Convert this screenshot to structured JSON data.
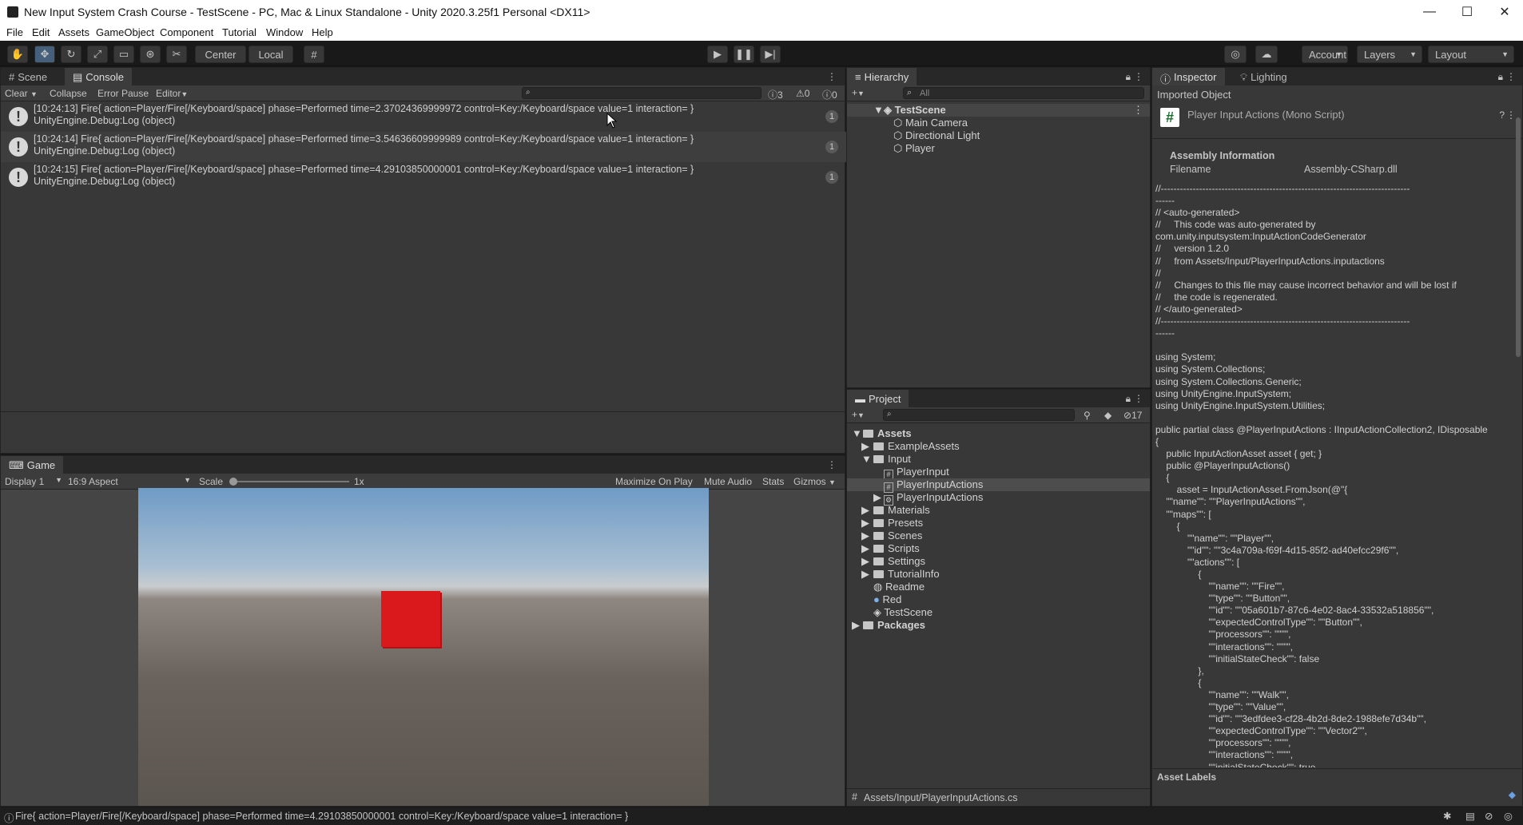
{
  "window": {
    "title": "New Input System Crash Course - TestScene - PC, Mac & Linux Standalone - Unity 2020.3.25f1 Personal <DX11>",
    "minimize": "—",
    "maximize": "☐",
    "close": "✕"
  },
  "menu": [
    "File",
    "Edit",
    "Assets",
    "GameObject",
    "Component",
    "Tutorial",
    "Window",
    "Help"
  ],
  "toolbar": {
    "pivot_center": "Center",
    "pivot_local": "Local",
    "account": "Account",
    "layers": "Layers",
    "layout": "Layout"
  },
  "console": {
    "tab_scene": "Scene",
    "tab_console": "Console",
    "clear": "Clear",
    "collapse": "Collapse",
    "error_pause": "Error Pause",
    "editor": "Editor",
    "count_log": "3",
    "count_warn": "0",
    "count_error": "0",
    "entries": [
      {
        "line1": "[10:24:13] Fire{ action=Player/Fire[/Keyboard/space] phase=Performed time=2.37024369999972 control=Key:/Keyboard/space value=1 interaction= }",
        "line2": "UnityEngine.Debug:Log (object)",
        "count": "1"
      },
      {
        "line1": "[10:24:14] Fire{ action=Player/Fire[/Keyboard/space] phase=Performed time=3.54636609999989 control=Key:/Keyboard/space value=1 interaction= }",
        "line2": "UnityEngine.Debug:Log (object)",
        "count": "1"
      },
      {
        "line1": "[10:24:15] Fire{ action=Player/Fire[/Keyboard/space] phase=Performed time=4.29103850000001 control=Key:/Keyboard/space value=1 interaction= }",
        "line2": "UnityEngine.Debug:Log (object)",
        "count": "1"
      }
    ]
  },
  "game": {
    "tab": "Game",
    "display": "Display 1",
    "aspect": "16:9 Aspect",
    "scale_label": "Scale",
    "scale_value": "1x",
    "maximize_on_play": "Maximize On Play",
    "mute_audio": "Mute Audio",
    "stats": "Stats",
    "gizmos": "Gizmos"
  },
  "hierarchy": {
    "tab": "Hierarchy",
    "search_placeholder": "All",
    "scene": "TestScene",
    "items": [
      "Main Camera",
      "Directional Light",
      "Player"
    ]
  },
  "project": {
    "tab": "Project",
    "hidden_count": "17",
    "path": "Assets/Input/PlayerInputActions.cs",
    "items": [
      {
        "label": "Assets",
        "kind": "folder",
        "bold": true
      },
      {
        "label": "ExampleAssets",
        "kind": "folder"
      },
      {
        "label": "Input",
        "kind": "folder"
      },
      {
        "label": "PlayerInput",
        "kind": "script"
      },
      {
        "label": "PlayerInputActions",
        "kind": "script"
      },
      {
        "label": "PlayerInputActions",
        "kind": "asset"
      },
      {
        "label": "Materials",
        "kind": "folder"
      },
      {
        "label": "Presets",
        "kind": "folder"
      },
      {
        "label": "Scenes",
        "kind": "folder"
      },
      {
        "label": "Scripts",
        "kind": "folder"
      },
      {
        "label": "Settings",
        "kind": "folder"
      },
      {
        "label": "TutorialInfo",
        "kind": "folder"
      },
      {
        "label": "Readme",
        "kind": "readme"
      },
      {
        "label": "Red",
        "kind": "material"
      },
      {
        "label": "TestScene",
        "kind": "scene"
      },
      {
        "label": "Packages",
        "kind": "folder",
        "bold": true
      }
    ]
  },
  "inspector": {
    "tab_inspector": "Inspector",
    "tab_lighting": "Lighting",
    "imported_object": "Imported Object",
    "object_title": "Player Input Actions (Mono Script)",
    "assembly_header": "Assembly Information",
    "filename_label": "Filename",
    "filename_value": "Assembly-CSharp.dll",
    "asset_labels": "Asset Labels",
    "code": "//------------------------------------------------------------------------------\n------\n// <auto-generated>\n//     This code was auto-generated by\ncom.unity.inputsystem:InputActionCodeGenerator\n//     version 1.2.0\n//     from Assets/Input/PlayerInputActions.inputactions\n//\n//     Changes to this file may cause incorrect behavior and will be lost if\n//     the code is regenerated.\n// </auto-generated>\n//------------------------------------------------------------------------------\n------\n\nusing System;\nusing System.Collections;\nusing System.Collections.Generic;\nusing UnityEngine.InputSystem;\nusing UnityEngine.InputSystem.Utilities;\n\npublic partial class @PlayerInputActions : IInputActionCollection2, IDisposable\n{\n    public InputActionAsset asset { get; }\n    public @PlayerInputActions()\n    {\n        asset = InputActionAsset.FromJson(@\"{\n    \"\"name\"\": \"\"PlayerInputActions\"\",\n    \"\"maps\"\": [\n        {\n            \"\"name\"\": \"\"Player\"\",\n            \"\"id\"\": \"\"3c4a709a-f69f-4d15-85f2-ad40efcc29f6\"\",\n            \"\"actions\"\": [\n                {\n                    \"\"name\"\": \"\"Fire\"\",\n                    \"\"type\"\": \"\"Button\"\",\n                    \"\"id\"\": \"\"05a601b7-87c6-4e02-8ac4-33532a518856\"\",\n                    \"\"expectedControlType\"\": \"\"Button\"\",\n                    \"\"processors\"\": \"\"\"\",\n                    \"\"interactions\"\": \"\"\"\",\n                    \"\"initialStateCheck\"\": false\n                },\n                {\n                    \"\"name\"\": \"\"Walk\"\",\n                    \"\"type\"\": \"\"Value\"\",\n                    \"\"id\"\": \"\"3edfdee3-cf28-4b2d-8de2-1988efe7d34b\"\",\n                    \"\"expectedControlType\"\": \"\"Vector2\"\",\n                    \"\"processors\"\": \"\"\"\",\n                    \"\"interactions\"\": \"\"\"\",\n                    \"\"initialStateCheck\"\": true"
  },
  "status": {
    "message": "Fire{ action=Player/Fire[/Keyboard/space] phase=Performed time=4.29103850000001 control=Key:/Keyboard/space value=1 interaction= }"
  },
  "colors": {
    "cube": "#d9191c",
    "selection": "#46607c"
  }
}
